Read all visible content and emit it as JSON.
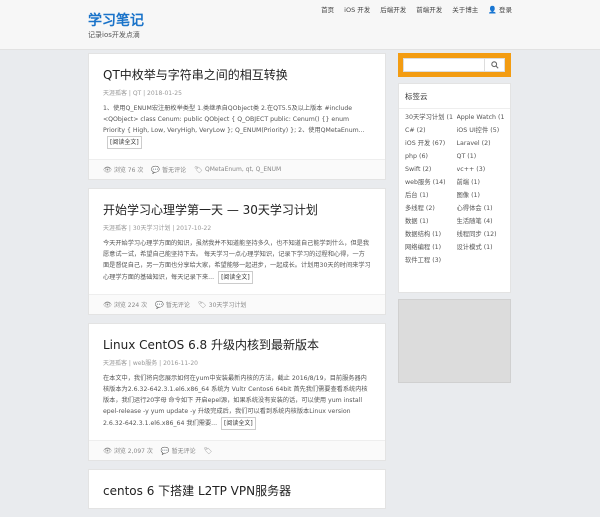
{
  "site": {
    "name": "学习笔记",
    "tagline": "记录ios开发点滴"
  },
  "nav": [
    {
      "label": "首页"
    },
    {
      "label": "iOS 开发"
    },
    {
      "label": "后端开发"
    },
    {
      "label": "前端开发"
    },
    {
      "label": "关于博主"
    },
    {
      "label": "登录"
    }
  ],
  "posts": [
    {
      "title": "QT中枚举与字符串之间的相互转换",
      "meta": "天涯孤客 | QT | 2018-01-25",
      "excerpt": "1、使用Q_ENUM宏注册枚举类型 1.类继承自QObject类 2.在QT5.5及以上版本  #include <QObject> class Cenum: public QObject { Q_OBJECT public: Cenum() {} enum Priority { High, Low, VeryHigh, VeryLow }; Q_ENUM(Priority) }; 2、使用QMetaEnum...",
      "readmore": "[阅读全文]",
      "views": "浏览 76 次",
      "comments": "暂无评论",
      "tags": "QMetaEnum, qt, Q_ENUM"
    },
    {
      "title": "开始学习心理学第一天 — 30天学习计划",
      "meta": "天涯孤客 | 30天学习计划 | 2017-10-22",
      "excerpt": "今天开始学习心理学方面的知识，虽然我并不知道能坚持多久，也不知道自己能学到什么，但是我愿意试一试，希望自己能坚持下去。 每天学习一点心理学知识，记录下学习的过程和心得，一方面是督促自己，另一方面也分享给大家，希望能够一起进步，一起成长。计划用30天的时间来学习心理学方面的基础知识，每天记录下来...",
      "readmore": "[阅读全文]",
      "views": "浏览 224 次",
      "comments": "暂无评论",
      "tags": "30天学习计划"
    },
    {
      "title": "Linux CentOS 6.8 升级内核到最新版本",
      "meta": "天涯孤客 | web服务 | 2016-11-20",
      "excerpt": "在本文中，我们将向您展示如何在yum中安装最新内核的方法，截止 2016/8/19，目前服务器内核版本为2.6.32-642.3.1.el6.x86_64 系统为 Vultr Centos6 64bit 首先我们需要查看系统内核版本，我们运行20字母 命令如下 开启epel源，如果系统没有安装的话，可以使用 yum install epel-release -y yum update -y 升级完成后，我们可以看到系统内核版本Linux version 2.6.32-642.3.1.el6.x86_64 我们需要...",
      "readmore": "[阅读全文]",
      "views": "浏览 2,097 次",
      "comments": "暂无评论",
      "tags": ""
    },
    {
      "title": "centos 6 下搭建 L2TP VPN服务器",
      "meta": "",
      "excerpt": "",
      "readmore": "",
      "views": "",
      "comments": "",
      "tags": ""
    }
  ],
  "sidebar": {
    "search_placeholder": "",
    "tags_title": "标签云",
    "tags": [
      "30天学习计划 (1)",
      "Apple Watch (1)",
      "C# (2)",
      "iOS UI控件 (5)",
      "iOS 开发 (67)",
      "Laravel (2)",
      "php (6)",
      "QT (1)",
      "Swift (2)",
      "vc++ (3)",
      "web服务 (14)",
      "前端 (1)",
      "后台 (1)",
      "图像 (1)",
      "多线程 (2)",
      "心得体会 (1)",
      "数据 (1)",
      "生活随笔 (4)",
      "数据结构 (1)",
      "线程同步 (12)",
      "网络编程 (1)",
      "设计模式 (1)",
      "软件工程 (3)"
    ]
  }
}
